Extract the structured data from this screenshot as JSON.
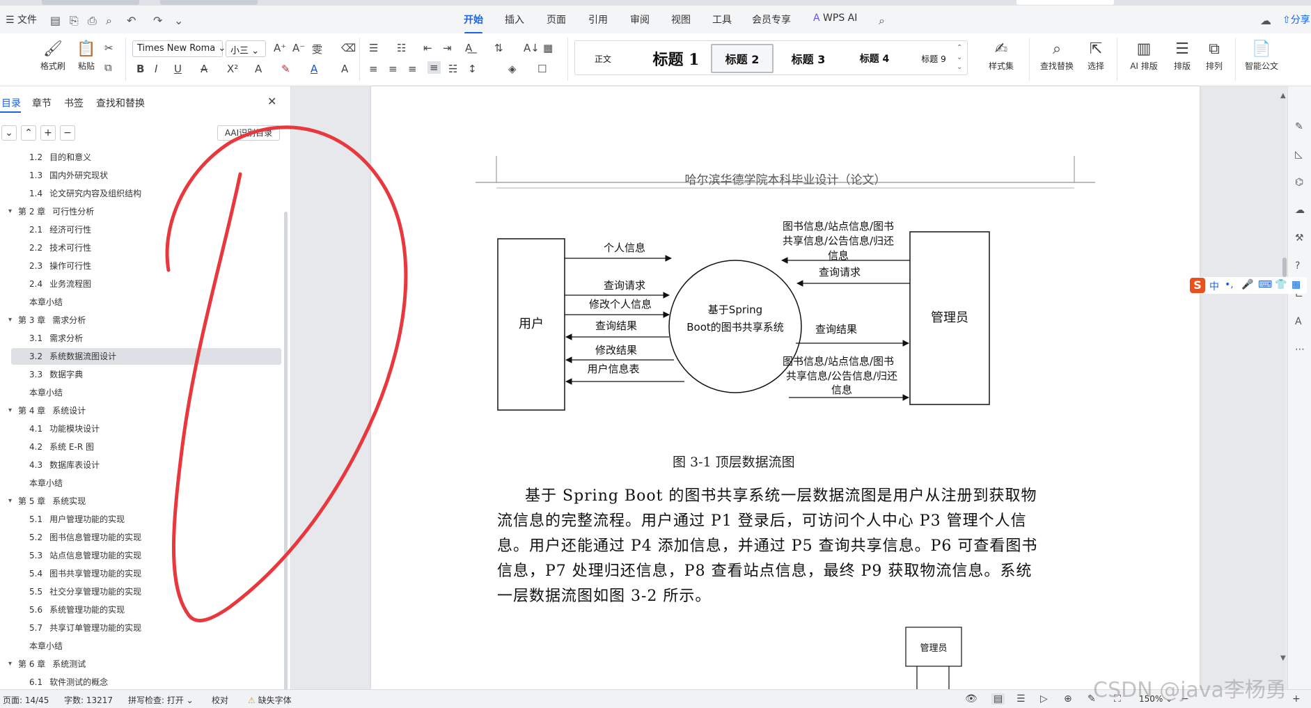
{
  "menubar": {
    "file_label": "文件",
    "tabs": [
      "开始",
      "插入",
      "页面",
      "引用",
      "审阅",
      "视图",
      "工具",
      "会员专享",
      "WPS AI"
    ],
    "active_tab": "开始",
    "share_label": "分享"
  },
  "ribbon": {
    "format_painter": "格式刷",
    "paste": "粘贴",
    "font_name": "Times New Roma",
    "font_size": "小三",
    "styles": [
      "正文",
      "标题 1",
      "标题 2",
      "标题 3",
      "标题 4",
      "标题 9"
    ],
    "selected_style": "标题 2",
    "style_set": "样式集",
    "find_replace": "查找替换",
    "select": "选择",
    "ai_layout": "AI 排版",
    "layout": "排版",
    "arrange": "排列",
    "smart_doc": "智能公文"
  },
  "navpane": {
    "tabs": [
      "目录",
      "章节",
      "书签",
      "查找和替换"
    ],
    "active_tab": "目录",
    "ai_toc_button": "AI识别目录",
    "toc": [
      {
        "num": "1.2",
        "text": "目的和意义",
        "level": 2
      },
      {
        "num": "1.3",
        "text": "国内外研究现状",
        "level": 2
      },
      {
        "num": "1.4",
        "text": "论文研究内容及组织结构",
        "level": 2
      },
      {
        "num": "第 2 章",
        "text": "可行性分析",
        "level": 1
      },
      {
        "num": "2.1",
        "text": "经济可行性",
        "level": 2
      },
      {
        "num": "2.2",
        "text": "技术可行性",
        "level": 2
      },
      {
        "num": "2.3",
        "text": "操作可行性",
        "level": 2
      },
      {
        "num": "2.4",
        "text": "业务流程图",
        "level": 2
      },
      {
        "num": "",
        "text": "本章小结",
        "level": 2
      },
      {
        "num": "第 3 章",
        "text": "需求分析",
        "level": 1
      },
      {
        "num": "3.1",
        "text": "需求分析",
        "level": 2
      },
      {
        "num": "3.2",
        "text": "系统数据流图设计",
        "level": 2,
        "selected": true
      },
      {
        "num": "3.3",
        "text": "数据字典",
        "level": 2
      },
      {
        "num": "",
        "text": "本章小结",
        "level": 2
      },
      {
        "num": "第 4 章",
        "text": "系统设计",
        "level": 1
      },
      {
        "num": "4.1",
        "text": "功能模块设计",
        "level": 2
      },
      {
        "num": "4.2",
        "text": "系统 E-R 图",
        "level": 2
      },
      {
        "num": "4.3",
        "text": "数据库表设计",
        "level": 2
      },
      {
        "num": "",
        "text": "本章小结",
        "level": 2
      },
      {
        "num": "第 5 章",
        "text": "系统实现",
        "level": 1
      },
      {
        "num": "5.1",
        "text": "用户管理功能的实现",
        "level": 2
      },
      {
        "num": "5.2",
        "text": "图书信息管理功能的实现",
        "level": 2
      },
      {
        "num": "5.3",
        "text": "站点信息管理功能的实现",
        "level": 2
      },
      {
        "num": "5.4",
        "text": "图书共享管理功能的实现",
        "level": 2
      },
      {
        "num": "5.5",
        "text": "社交分享管理功能的实现",
        "level": 2
      },
      {
        "num": "5.6",
        "text": "系统管理功能的实现",
        "level": 2
      },
      {
        "num": "5.7",
        "text": "共享订单管理功能的实现",
        "level": 2
      },
      {
        "num": "",
        "text": "本章小结",
        "level": 2
      },
      {
        "num": "第 6 章",
        "text": "系统测试",
        "level": 1
      },
      {
        "num": "6.1",
        "text": "软件测试的概念",
        "level": 2
      }
    ]
  },
  "document": {
    "header": "哈尔滨华德学院本科毕业设计（论文）",
    "dfd": {
      "user": "用户",
      "admin": "管理员",
      "center_line1": "基于Spring",
      "center_line2": "Boot的图书共享系统",
      "left_flows": [
        "个人信息",
        "查询请求",
        "修改个人信息",
        "查询结果",
        "修改结果",
        "用户信息表"
      ],
      "right_top_line1": "图书信息/站点信息/图书",
      "right_top_line2": "共享信息/公告信息/归还",
      "right_top_line3": "信息",
      "right_query": "查询请求",
      "right_result": "查询结果",
      "right_bottom_line1": "图书信息/站点信息/图书",
      "right_bottom_line2": "共享信息/公告信息/归还",
      "right_bottom_line3": "信息"
    },
    "caption": "图 3-1  顶层数据流图",
    "paragraph_lines": [
      "基于 Spring Boot 的图书共享系统一层数据流图是用户从注册到获取物",
      "流信息的完整流程。用户通过 P1 登录后，可访问个人中心 P3 管理个人信",
      "息。用户还能通过 P4 添加信息，并通过 P5 查询共享信息。P6 可查看图书",
      "信息，P7 处理归还信息，P8 查看站点信息，最终 P9 获取物流信息。系统",
      "一层数据流图如图 3-2 所示。"
    ],
    "next_fig_label": "管理员"
  },
  "ime": {
    "label": "中"
  },
  "statusbar": {
    "page": "页面: 14/45",
    "words": "字数: 13217",
    "spellcheck": "拼写检查: 打开",
    "proofread": "校对",
    "missing_font": "缺失字体",
    "zoom": "150%"
  },
  "watermark": "CSDN @java李杨勇"
}
